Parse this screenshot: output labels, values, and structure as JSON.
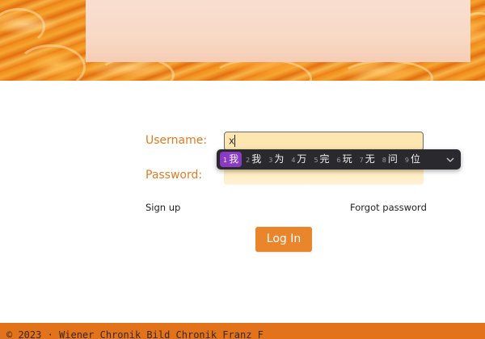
{
  "banner": {
    "panel_color": "#f8d9c6",
    "accent": "#f08a1a"
  },
  "form": {
    "username_label": "Username:",
    "username_value": "x",
    "password_label": "Password:",
    "password_value": "",
    "label_color": "#e07b22",
    "input_bg": "#fde6b0"
  },
  "ime": {
    "candidates": [
      {
        "num": "1",
        "char": "我",
        "selected": true
      },
      {
        "num": "2",
        "char": "我",
        "selected": false
      },
      {
        "num": "3",
        "char": "为",
        "selected": false
      },
      {
        "num": "4",
        "char": "万",
        "selected": false
      },
      {
        "num": "5",
        "char": "完",
        "selected": false
      },
      {
        "num": "6",
        "char": "玩",
        "selected": false
      },
      {
        "num": "7",
        "char": "无",
        "selected": false
      },
      {
        "num": "8",
        "char": "问",
        "selected": false
      },
      {
        "num": "9",
        "char": "位",
        "selected": false
      }
    ],
    "expand_icon": "chevron-down-icon",
    "selected_color": "#8a3bc4"
  },
  "links": {
    "sign_up": "Sign up",
    "forgot_password": "Forgot password"
  },
  "login_button": {
    "label": "Log In",
    "color": "#e9852b"
  },
  "footer": {
    "text": "© 2023 · Wiener Chronik Bild Chronik Franz F",
    "color": "#e2731b"
  }
}
